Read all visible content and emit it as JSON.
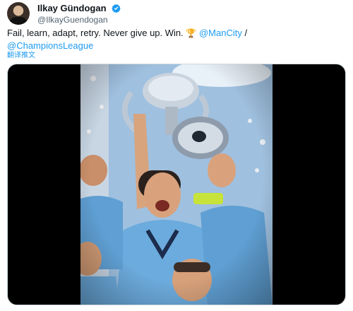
{
  "tweet": {
    "display_name": "Ilkay Gündogan",
    "handle": "@IlkayGuendogan",
    "text_main": "Fail, learn, adapt, retry. Never give up. Win.",
    "mention_1": "@ManCity",
    "separator": "/",
    "mention_2": "@ChampionsLeague",
    "translate_label": "翻译推文"
  },
  "icons": {
    "verified": "verified-badge-icon",
    "trophy": "trophy-emoji"
  },
  "colors": {
    "link": "#1d9bf0",
    "verified": "#1d9bf0",
    "secondary_text": "#536471",
    "jersey": "#6cabdd"
  }
}
